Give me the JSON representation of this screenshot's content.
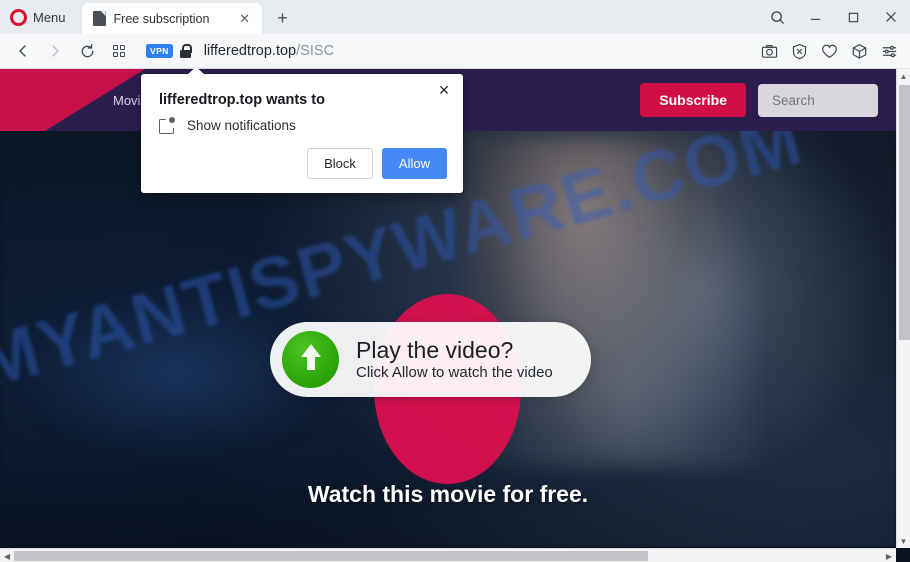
{
  "browser": {
    "menu_label": "Menu",
    "logo_name": "opera-logo",
    "tab": {
      "title": "Free subscription",
      "favicon_name": "page-favicon",
      "close_label": "✕"
    },
    "new_tab_label": "+",
    "window_controls": {
      "search_label": "search-icon",
      "minimize_label": "—",
      "maximize_label": "□",
      "close_label": "✕"
    },
    "toolbar": {
      "back_label": "‹",
      "forward_label": "›",
      "reload_label": "↻",
      "speeddial_label": "speed-dial-icon",
      "vpn_badge": "VPN",
      "url_host": "lifferedtrop.top",
      "url_path": "/SISC",
      "icons": [
        {
          "name": "snapshot-icon",
          "glyph": "camera"
        },
        {
          "name": "ad-blocker-icon",
          "glyph": "shield-x"
        },
        {
          "name": "favorites-heart-icon",
          "glyph": "heart"
        },
        {
          "name": "crypto-wallet-icon",
          "glyph": "cube"
        },
        {
          "name": "easy-setup-icon",
          "glyph": "sliders"
        }
      ]
    }
  },
  "permission_dialog": {
    "title": "lifferedtrop.top wants to",
    "permission_label": "Show notifications",
    "permission_icon": "notification-icon",
    "block_label": "Block",
    "allow_label": "Allow",
    "close_label": "✕",
    "allow_button_color": "#4489f5"
  },
  "page": {
    "site_header": {
      "nav_item": "Movies",
      "subscribe_label": "Subscribe",
      "search_placeholder": "Search",
      "header_color": "#2c1d4f",
      "accent_color": "#c8114a"
    },
    "watermark_text": "MYANTISPYWARE.COM",
    "play_card": {
      "title": "Play the video?",
      "subtitle": "Click Allow to watch the video",
      "icon_name": "green-up-arrow-icon",
      "icon_color": "#2faa0c"
    },
    "free_text": "Watch this movie for free."
  },
  "scrollbars": {
    "vertical_up": "▲",
    "vertical_down": "▼",
    "horizontal_left": "◀",
    "horizontal_right": "▶"
  }
}
